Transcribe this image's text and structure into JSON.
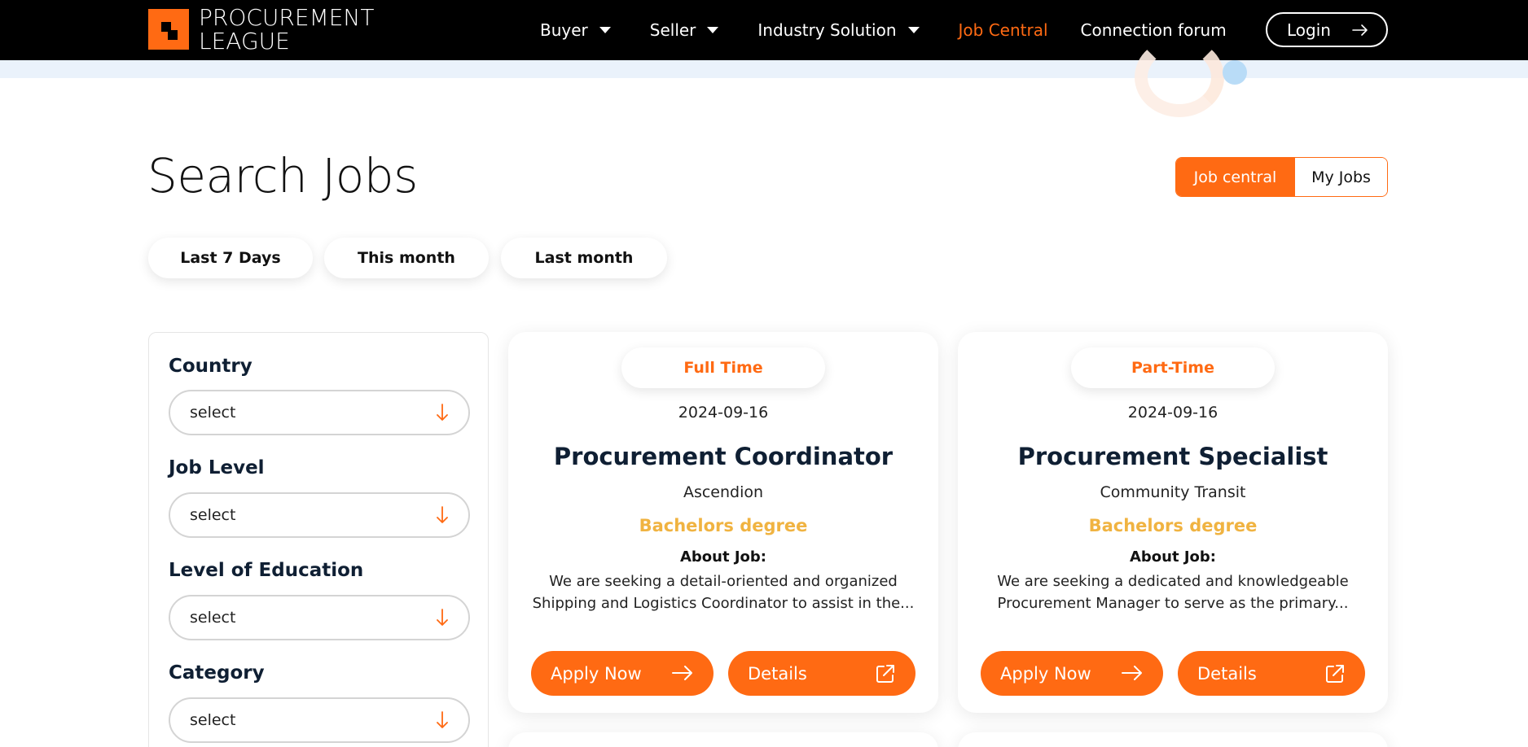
{
  "brand": {
    "line1": "PROCUREMENT",
    "line2": "LEAGUE",
    "accent_color": "#ff6a13"
  },
  "nav": {
    "items": [
      {
        "label": "Buyer"
      },
      {
        "label": "Seller"
      },
      {
        "label": "Industry Solution"
      },
      {
        "label": "Job Central"
      },
      {
        "label": "Connection forum"
      }
    ],
    "login_label": "Login",
    "login_icon": "arrow-right-icon"
  },
  "page": {
    "title": "Search Jobs"
  },
  "toggle": {
    "job_central": "Job central",
    "my_jobs": "My Jobs"
  },
  "date_filters": [
    "Last 7 Days",
    "This month",
    "Last month"
  ],
  "filters": [
    {
      "label": "Country",
      "value": "select"
    },
    {
      "label": "Job Level",
      "value": "select"
    },
    {
      "label": "Level of Education",
      "value": "select"
    },
    {
      "label": "Category",
      "value": "select"
    }
  ],
  "jobs": [
    {
      "type": "Full Time",
      "date": "2024-09-16",
      "title": "Procurement Coordinator",
      "company": "Ascendion",
      "education": "Bachelors degree",
      "about_label": "About Job:",
      "desc_line1": "We are seeking a detail-oriented and organized",
      "desc_line2": "Shipping and Logistics Coordinator to assist in the...",
      "apply_label": "Apply Now",
      "details_label": "Details"
    },
    {
      "type": "Part-Time",
      "date": "2024-09-16",
      "title": "Procurement Specialist",
      "company": "Community Transit",
      "education": "Bachelors degree",
      "about_label": "About Job:",
      "desc_line1": "We are seeking a dedicated and knowledgeable",
      "desc_line2": "Procurement Manager to serve as the primary...",
      "apply_label": "Apply Now",
      "details_label": "Details"
    }
  ]
}
